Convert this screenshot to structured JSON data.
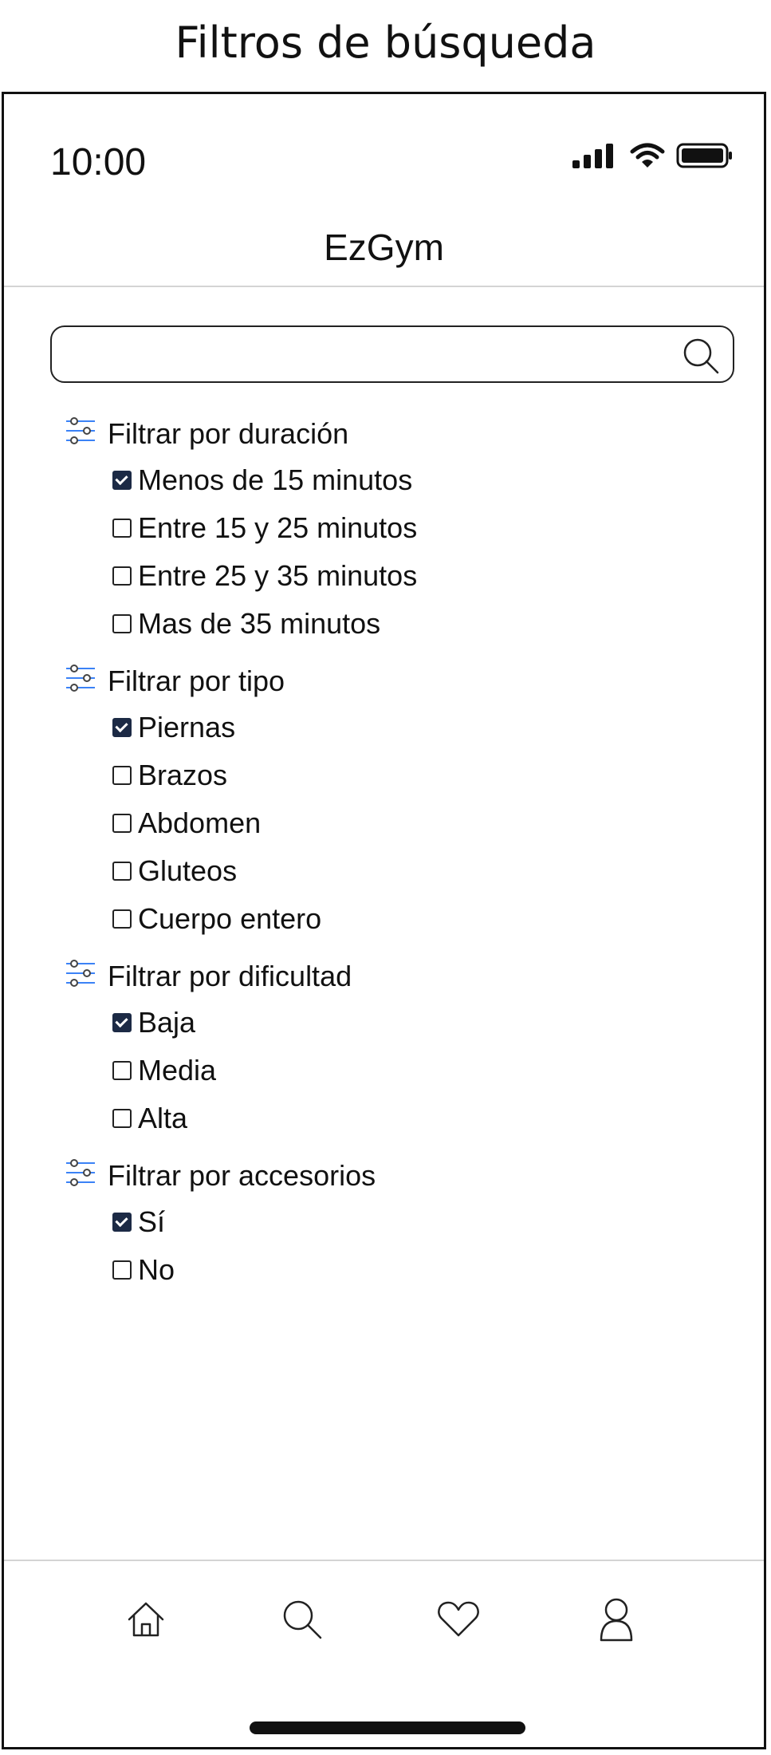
{
  "caption": "Filtros de búsqueda",
  "status_bar": {
    "time": "10:00",
    "icons": [
      "signal-icon",
      "wifi-icon",
      "battery-icon"
    ]
  },
  "app": {
    "title": "EzGym"
  },
  "search": {
    "value": "",
    "placeholder": "",
    "icon": "search-icon"
  },
  "filter_groups": [
    {
      "heading": "Filtrar por duración",
      "icon": "sliders-icon",
      "options": [
        {
          "label": "Menos de 15 minutos",
          "checked": true
        },
        {
          "label": "Entre 15 y 25 minutos",
          "checked": false
        },
        {
          "label": "Entre 25 y 35 minutos",
          "checked": false
        },
        {
          "label": "Mas de 35 minutos",
          "checked": false
        }
      ]
    },
    {
      "heading": "Filtrar por tipo",
      "icon": "sliders-icon",
      "options": [
        {
          "label": "Piernas",
          "checked": true
        },
        {
          "label": "Brazos",
          "checked": false
        },
        {
          "label": "Abdomen",
          "checked": false
        },
        {
          "label": "Gluteos",
          "checked": false
        },
        {
          "label": "Cuerpo entero",
          "checked": false
        }
      ]
    },
    {
      "heading": "Filtrar por dificultad",
      "icon": "sliders-icon",
      "options": [
        {
          "label": "Baja",
          "checked": true
        },
        {
          "label": "Media",
          "checked": false
        },
        {
          "label": "Alta",
          "checked": false
        }
      ]
    },
    {
      "heading": "Filtrar por accesorios",
      "icon": "sliders-icon",
      "options": [
        {
          "label": "Sí",
          "checked": true
        },
        {
          "label": "No",
          "checked": false
        }
      ]
    }
  ],
  "bottom_nav": [
    "home-icon",
    "search-icon",
    "heart-icon",
    "profile-icon"
  ],
  "colors": {
    "checkbox_checked": "#1c2a45",
    "sliders_accent": "#3b82f6",
    "divider": "#d4d4d4"
  }
}
